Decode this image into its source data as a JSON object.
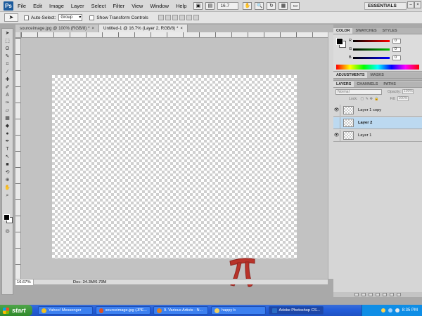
{
  "app": {
    "logo_text": "Ps",
    "menu": [
      "File",
      "Edit",
      "Image",
      "Layer",
      "Select",
      "Filter",
      "View",
      "Window",
      "Help"
    ],
    "zoom_field": "16.7",
    "workspace": "ESSENTIALS"
  },
  "options_bar": {
    "auto_select_label": "Auto-Select:",
    "auto_select_value": "Group",
    "transform_label": "Show Transform Controls"
  },
  "tabs": [
    {
      "label": "sourceimage.jpg @ 100% (RGB/8) *",
      "close": "×",
      "active": false
    },
    {
      "label": "Untitled-1 @ 16.7% (Layer 2, RGB/8) *",
      "close": "×",
      "active": true
    }
  ],
  "status": {
    "zoom": "16.67%",
    "doc": "Doc: 34.3M/6.79M"
  },
  "color_panel": {
    "tabs": [
      "COLOR",
      "SWATCHES",
      "STYLES"
    ],
    "sliders": [
      {
        "label": "R",
        "value": "0",
        "gradient": "#ff0000"
      },
      {
        "label": "G",
        "value": "0",
        "gradient": "#00c000"
      },
      {
        "label": "B",
        "value": "0",
        "gradient": "#0000ff"
      }
    ]
  },
  "adjustments_panel": {
    "tabs": [
      "ADJUSTMENTS",
      "MASKS"
    ]
  },
  "layers_panel": {
    "tabs": [
      "LAYERS",
      "CHANNELS",
      "PATHS"
    ],
    "blend_mode": "Normal",
    "opacity_label": "Opacity:",
    "opacity": "100%",
    "lock_label": "Lock:",
    "fill_label": "Fill:",
    "fill": "100%",
    "layers": [
      {
        "name": "Layer 1 copy",
        "visible": true,
        "selected": false
      },
      {
        "name": "Layer 2",
        "visible": false,
        "selected": true
      },
      {
        "name": "Layer 1",
        "visible": true,
        "selected": false
      }
    ]
  },
  "taskbar": {
    "start": "start",
    "items": [
      {
        "label": "Yahoo! Messenger",
        "icon_color": "#f0c020",
        "active": false
      },
      {
        "label": "sourceimage.jpg (JPE...",
        "icon_color": "#e05020",
        "active": false
      },
      {
        "label": "9. Various Artists - N...",
        "icon_color": "#e08020",
        "active": false
      },
      {
        "label": "happy b",
        "icon_color": "#f0d060",
        "active": false
      },
      {
        "label": "Adobe Photoshop CS...",
        "icon_color": "#2a6cc4",
        "active": true
      }
    ],
    "clock": "8:35 PM"
  },
  "colors": {
    "shape_red": "#b8332a",
    "selection_blue": "#bcd9f0"
  }
}
